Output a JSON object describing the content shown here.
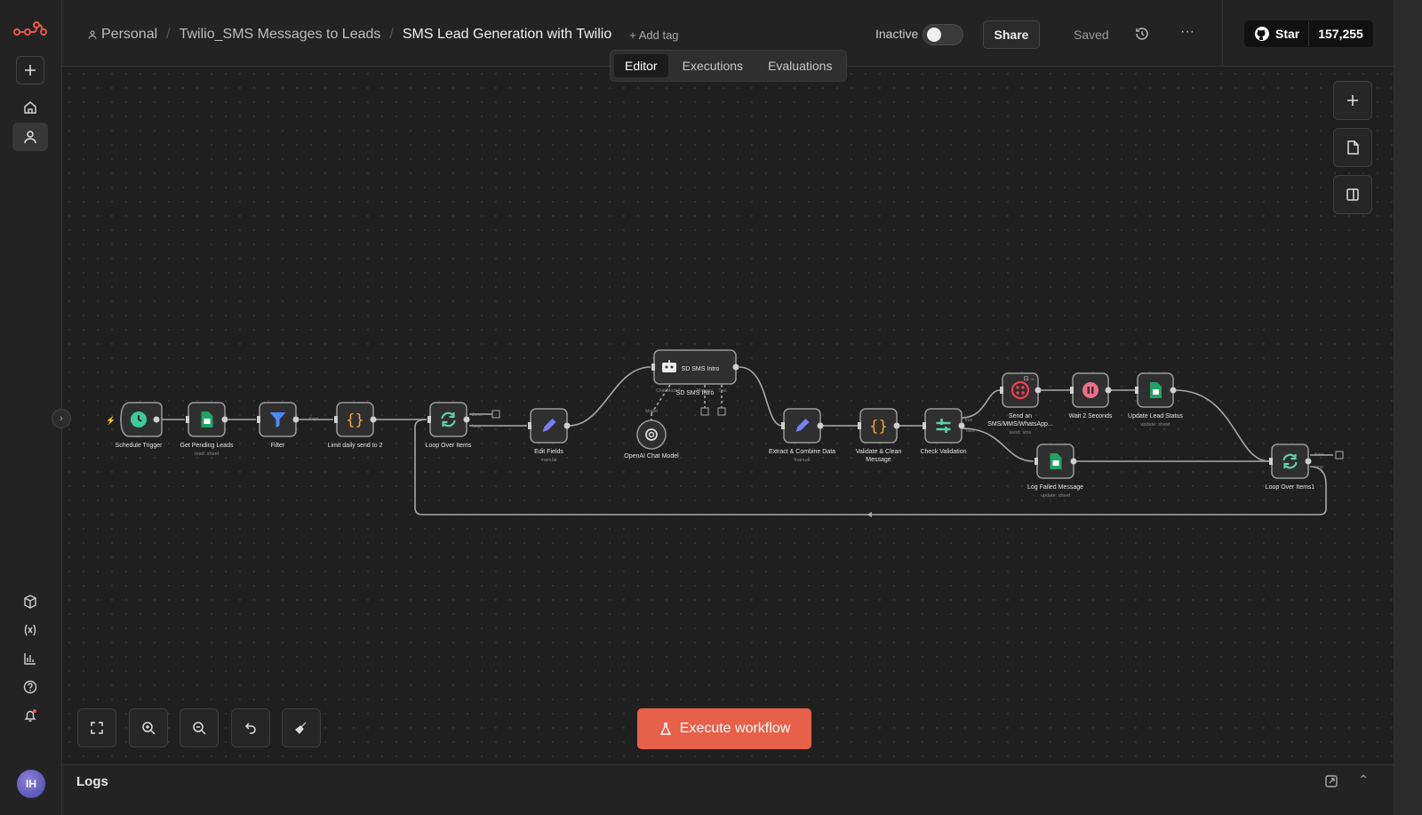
{
  "breadcrumb": {
    "personal": "Personal",
    "folder": "Twilio_SMS Messages to Leads",
    "workflow": "SMS Lead Generation with Twilio",
    "add_tag": "+ Add tag"
  },
  "header": {
    "status": "Inactive",
    "share": "Share",
    "saved": "Saved",
    "github_star": "Star",
    "github_count": "157,255"
  },
  "tabs": [
    "Editor",
    "Executions",
    "Evaluations"
  ],
  "active_tab": "Editor",
  "execute_label": "Execute workflow",
  "logs_label": "Logs",
  "avatar_initials": "IH",
  "colors": {
    "accent": "#e7604a",
    "node_bg": "#2f2f2f",
    "node_border": "#9a9a9a",
    "connection": "#a8a8a8",
    "clock": "#3ec99a",
    "sheets": "#21a366",
    "filter": "#4a8cf7",
    "code": "#f7a23b",
    "loop": "#5fd0a8",
    "edit": "#7a7ff6",
    "twilio": "#f0404e"
  },
  "nodes": {
    "schedule": {
      "title": "Schedule Trigger",
      "sub": "",
      "icon": "clock-icon"
    },
    "get_leads": {
      "title": "Get Pending Leads",
      "sub": "read: sheet",
      "icon": "sheets-icon"
    },
    "filter": {
      "title": "Filter",
      "sub": "",
      "icon": "filter-icon"
    },
    "limit": {
      "title": "Limit daily send to 2",
      "sub": "",
      "icon": "code-icon"
    },
    "loop": {
      "title": "Loop Over Items",
      "sub": "",
      "icon": "loop-icon",
      "out1": "done",
      "out2": "loop"
    },
    "edit_fields": {
      "title": "Edit Fields",
      "sub": "manual",
      "icon": "pencil-icon"
    },
    "sd_sms": {
      "title": "SD SMS Intro",
      "sub": "",
      "icon": "robot-icon",
      "port1": "Chat Model*",
      "port2": "Memory",
      "port3": "Tool"
    },
    "openai": {
      "title": "OpenAI Chat Model",
      "sub": "",
      "icon": "openai-icon",
      "port": "Model"
    },
    "extract": {
      "title": "Extract & Combine Data",
      "sub": "manual",
      "icon": "pencil-icon"
    },
    "validate": {
      "title": "Validate & Clean Message",
      "sub": "",
      "icon": "code-icon"
    },
    "check": {
      "title": "Check Validation",
      "sub": "",
      "icon": "if-icon",
      "out1": "true",
      "out2": "false"
    },
    "send": {
      "title": "Send an SMS/MMS/WhatsApp...",
      "sub": "send: sms",
      "icon": "twilio-icon"
    },
    "wait": {
      "title": "Wait 2 Seconds",
      "sub": "",
      "icon": "pause-icon"
    },
    "update": {
      "title": "Update Lead Status",
      "sub": "update: sheet",
      "icon": "sheets-icon"
    },
    "log_failed": {
      "title": "Log Failed Message",
      "sub": "update: sheet",
      "icon": "sheets-icon"
    },
    "loop2": {
      "title": "Loop Over Items1",
      "sub": "",
      "icon": "loop-icon",
      "out1": "done",
      "out2": "loop"
    }
  }
}
